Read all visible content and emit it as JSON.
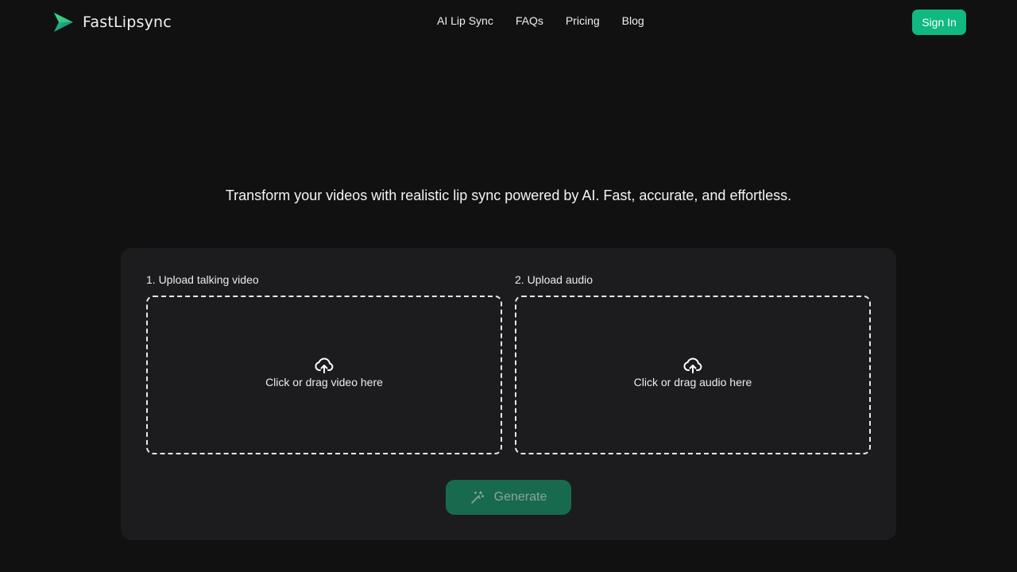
{
  "brand": {
    "name": "FastLipsync",
    "logo_icon": "play-arrow-logo"
  },
  "nav": {
    "items": [
      {
        "label": "AI Lip Sync"
      },
      {
        "label": "FAQs"
      },
      {
        "label": "Pricing"
      },
      {
        "label": "Blog"
      }
    ],
    "signin_label": "Sign In"
  },
  "hero": {
    "tagline": "Transform your videos with realistic lip sync powered by AI. Fast, accurate, and effortless."
  },
  "uploader": {
    "video": {
      "label": "1. Upload talking video",
      "prompt": "Click or drag video here",
      "icon": "cloud-upload-icon"
    },
    "audio": {
      "label": "2. Upload audio",
      "prompt": "Click or drag audio here",
      "icon": "cloud-upload-icon"
    },
    "generate_label": "Generate",
    "generate_icon": "magic-wand-icon"
  },
  "colors": {
    "accent": "#10b981",
    "background": "#111112",
    "panel": "#1c1c1f",
    "generate_disabled": "#176a4e"
  }
}
